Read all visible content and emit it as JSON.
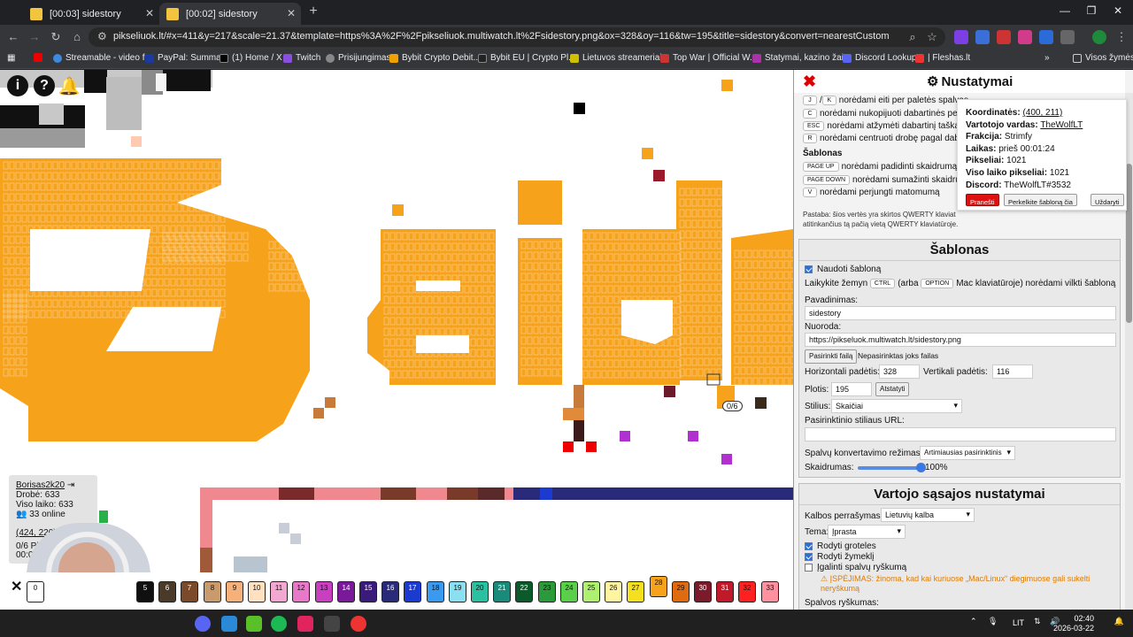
{
  "browser": {
    "tabs": [
      {
        "label": "[00:03] sidestory"
      },
      {
        "label": "[00:02] sidestory"
      }
    ],
    "url": "pikseliuok.lt/#x=411&y=217&scale=21.37&template=https%3A%2F%2Fpikseliuok.multiwatch.lt%2Fsidestory.png&ox=328&oy=116&tw=195&title=sidestory&convert=nearestCustom",
    "bookmarks": [
      "Streamable - video f...",
      "PayPal: Summary",
      "(1) Home / X",
      "Twitch",
      "Prisijungimas",
      "Bybit Crypto Debit...",
      "Bybit EU | Crypto Pl...",
      "Lietuvos streameriai...",
      "Top War | Official W...",
      "Statymai, kazino žai...",
      "Discord Lookup",
      "| Fleshas.lt"
    ],
    "bookmarks_folder": "Visos žymės"
  },
  "hud": {
    "info": "i",
    "help": "?",
    "username": "Borisas2k20",
    "board_label": "Drobė: 633",
    "alltime_label": "Viso laiko: 633",
    "online_label": "33 online",
    "coords": "(424, 220)",
    "placed": "0/6 Pikseliai",
    "timer": "00:02",
    "progress_badge": "0/6"
  },
  "palette": {
    "colors": [
      {
        "n": "0",
        "c": "#ffffff"
      },
      {
        "n": "5",
        "c": "#101010"
      },
      {
        "n": "6",
        "c": "#4a3a2a"
      },
      {
        "n": "7",
        "c": "#7a4a2a"
      },
      {
        "n": "8",
        "c": "#c99a6b"
      },
      {
        "n": "9",
        "c": "#f6b07a"
      },
      {
        "n": "10",
        "c": "#ffe0c0"
      },
      {
        "n": "11",
        "c": "#f3a8d0"
      },
      {
        "n": "12",
        "c": "#e878c8"
      },
      {
        "n": "13",
        "c": "#c83fc0"
      },
      {
        "n": "14",
        "c": "#7a1a9a"
      },
      {
        "n": "15",
        "c": "#3a1a7a"
      },
      {
        "n": "16",
        "c": "#2a2a7a"
      },
      {
        "n": "17",
        "c": "#1a3ad0"
      },
      {
        "n": "18",
        "c": "#3a9af0"
      },
      {
        "n": "19",
        "c": "#8ae0f0"
      },
      {
        "n": "20",
        "c": "#2ac0a0"
      },
      {
        "n": "21",
        "c": "#1a8a7a"
      },
      {
        "n": "22",
        "c": "#0a5a2a"
      },
      {
        "n": "23",
        "c": "#2a9a3a"
      },
      {
        "n": "24",
        "c": "#5ad04a"
      },
      {
        "n": "25",
        "c": "#b0f070"
      },
      {
        "n": "26",
        "c": "#fff4a0"
      },
      {
        "n": "27",
        "c": "#f5e020"
      },
      {
        "n": "28",
        "c": "#f7a21b"
      },
      {
        "n": "29",
        "c": "#e06a10"
      },
      {
        "n": "30",
        "c": "#7a1a2a"
      },
      {
        "n": "31",
        "c": "#c01a2a"
      },
      {
        "n": "32",
        "c": "#ff2020"
      },
      {
        "n": "33",
        "c": "#ff90a0"
      }
    ],
    "selected": "28"
  },
  "panel": {
    "title": "Nustatymai",
    "shortcuts": [
      {
        "keys": [
          "J",
          "K"
        ],
        "text": "norėdami eiti per paletės spalvas"
      },
      {
        "keys": [
          "C"
        ],
        "text": "norėdami nukopijuoti dabartinės pele"
      },
      {
        "keys": [
          "ESC"
        ],
        "text": "norėdami atžymėti dabartinį taška"
      },
      {
        "keys": [
          "R"
        ],
        "text": "norėdami centruoti drobę pagal dab"
      }
    ],
    "template_shortcuts_title": "Šablonas",
    "template_shortcuts": [
      {
        "keys": [
          "PAGE UP"
        ],
        "text": "norėdami padidinti skaidrumą"
      },
      {
        "keys": [
          "PAGE DOWN"
        ],
        "text": "norėdami sumažinti skaidrum"
      },
      {
        "keys": [
          "V"
        ],
        "text": "norėdami perjungti matomumą"
      }
    ],
    "note_line1": "Pastaba: šios vertės yra skirtos QWERTY klaviat",
    "note_line2": "atitinkančius tą pačią vietą QWERTY klaviatūroje.",
    "template": {
      "title": "Šablonas",
      "use_label": "Naudoti šabloną",
      "hold_text_a": "Laikykite žemyn",
      "ctrl": "CTRL",
      "hold_text_b": "(arba",
      "option": "OPTION",
      "hold_text_c": "Mac klaviatūroje) norėdami vilkti šabloną",
      "name_label": "Pavadinimas:",
      "name_value": "sidestory",
      "url_label": "Nuoroda:",
      "url_value": "https://pikseluok.multiwatch.lt/sidestory.png",
      "file_button": "Pasirinkti failą",
      "file_status": "Nepasirinktas joks failas",
      "hpos_label": "Horizontali padėtis:",
      "hpos_value": "328",
      "vpos_label": "Vertikali padėtis:",
      "vpos_value": "116",
      "width_label": "Plotis:",
      "width_value": "195",
      "reset_button": "Atstatyti",
      "style_label": "Stilius:",
      "style_value": "Skaičiai",
      "custom_style_label": "Pasirinktinio stiliaus URL:",
      "convert_label": "Spalvų konvertavimo režimas:",
      "convert_value": "Artimiausias pasirinktinis",
      "opacity_label": "Skaidrumas:",
      "opacity_value": "100%",
      "opacity_fraction": 1.0
    },
    "ui": {
      "title": "Vartojo sąsajos nustatymai",
      "lang_label": "Kalbos perrašymas:",
      "lang_value": "Lietuvių kalba",
      "theme_label": "Tema:",
      "theme_value": "Įprasta",
      "grid_label": "Rodyti groteles",
      "cursor_label": "Rodyti žymeklį",
      "brightness_label": "Įgalinti spalvų ryškumą",
      "warning": "ĮSPĖJIMAS: žinoma, kad kai kuriuose „Mac/Linux“ diegimuose gali sukelti neryškumą",
      "brightness_value_label": "Spalvos ryškumas:"
    }
  },
  "popup": {
    "coords_label": "Koordinatės:",
    "coords_value": "(400, 211)",
    "user_label": "Vartotojo vardas:",
    "user_value": "TheWolfLT",
    "faction_label": "Frakcija:",
    "faction_value": "Strimfy",
    "time_label": "Laikas:",
    "time_value": "prieš 00:01:24",
    "pixels_label": "Pikseliai:",
    "pixels_value": "1021",
    "alltime_label": "Viso laiko pikseliai:",
    "alltime_value": "1021",
    "discord_label": "Discord:",
    "discord_value": "TheWolfLT#3532",
    "report": "Pranešti",
    "move_template": "Perkelkite šabloną čia",
    "close": "Uždaryti"
  },
  "taskbar": {
    "lang": "LIT",
    "time": "02:40",
    "date": "2026-03-22"
  },
  "colors": {
    "template_orange": "#f7a21b",
    "accent_blue": "#2e6fd6",
    "close_red": "#d00000"
  }
}
